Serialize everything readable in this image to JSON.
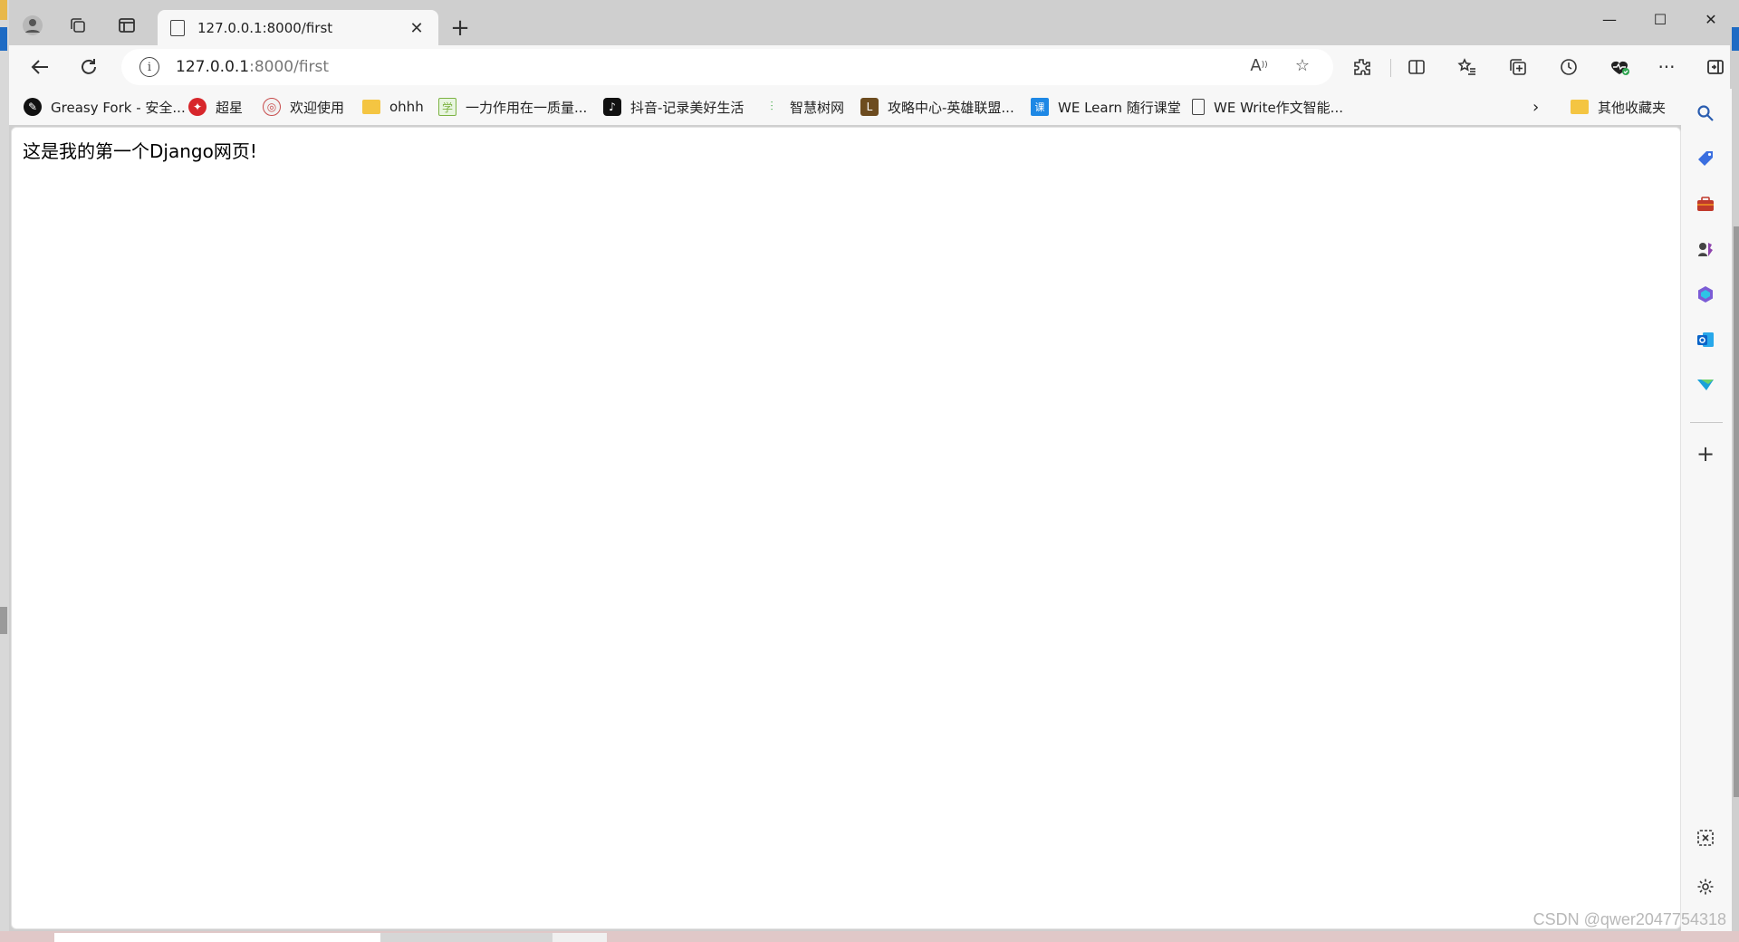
{
  "tab": {
    "title": "127.0.0.1:8000/first"
  },
  "address": {
    "host": "127.0.0.1",
    "path": ":8000/first"
  },
  "bookmarks": [
    {
      "label": "Greasy Fork - 安全...",
      "icon": "greasyfork-icon",
      "color": "#111111"
    },
    {
      "label": "超星",
      "icon": "chaoxing-icon",
      "color": "#d7262b"
    },
    {
      "label": "欢迎使用",
      "icon": "site-icon",
      "color": "#c84c4c"
    },
    {
      "label": "ohhh",
      "icon": "folder-icon",
      "color": "#f4c542"
    },
    {
      "label": "一力作用在一质量...",
      "icon": "page-icon",
      "color": "#7cb342"
    },
    {
      "label": "抖音-记录美好生活",
      "icon": "tiktok-icon",
      "color": "#111111"
    },
    {
      "label": "智慧树网",
      "icon": "zhihuishu-icon",
      "color": "#4caf50"
    },
    {
      "label": "攻略中心-英雄联盟...",
      "icon": "lol-icon",
      "color": "#6d4c1f"
    },
    {
      "label": "WE Learn 随行课堂",
      "icon": "welearn-icon",
      "color": "#1e88e5"
    },
    {
      "label": "WE Write作文智能...",
      "icon": "document-icon",
      "color": "#444444"
    }
  ],
  "other_favorites": "其他收藏夹",
  "page": {
    "text": "这是我的第一个Django网页!"
  },
  "watermark": "CSDN @qwer2047754318",
  "colors": {
    "accent": "#1e6bc4",
    "tabstrip": "#cfcfcf",
    "toolbar": "#f7f7f7"
  }
}
